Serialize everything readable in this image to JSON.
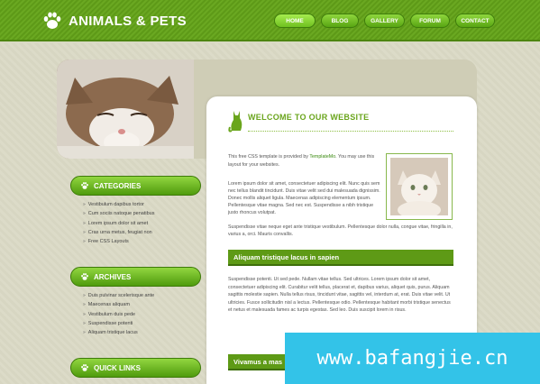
{
  "header": {
    "logo_text": "ANIMALS & PETS",
    "nav": [
      {
        "label": "HOME",
        "active": true,
        "w": 46
      },
      {
        "label": "BLOG",
        "active": false,
        "w": 42
      },
      {
        "label": "GALLERY",
        "active": false,
        "w": 45
      },
      {
        "label": "FORUM",
        "active": false,
        "w": 44
      },
      {
        "label": "CONTACT",
        "active": false,
        "w": 44
      }
    ]
  },
  "sidebar": {
    "categories": {
      "title": "CATEGORIES",
      "items": [
        "Vestibulum dapibus tortor",
        "Cum sociis natoque penatibus",
        "Lorem ipsum dolor sit amet",
        "Cras urna metus, feugiat non",
        "Free CSS Layouts"
      ]
    },
    "archives": {
      "title": "ARCHIVES",
      "items": [
        "Duis pulvinar scelerisque ante",
        "Maecenas aliquam",
        "Vestibulum duis pede",
        "Suspendisse potenti",
        "Aliquam tristique lacus"
      ]
    },
    "quick_links": {
      "title": "QUICK LINKS"
    }
  },
  "main": {
    "welcome_title": "WELCOME TO OUR WEBSITE",
    "intro_prefix": "This free CSS template is provided by",
    "intro_link": "TemplateMo",
    "intro_suffix": ". You may use this layout for your websites.",
    "para2": "Lorem ipsum dolor sit amet, consectetuer adipiscing elit. Nunc quis sem nec tellus blandit tincidunt. Duis vitae velit sed dui malesuada dignissim. Donec mollis aliquet ligula. Maecenas adipiscing elementum ipsum. Pellentesque vitae magna. Sed nec est. Suspendisse a nibh tristique justo rhoncus volutpat.",
    "para2b": "Suspendisse vitae neque eget ante tristique vestibulum. Pellentesque dolor nulla, congue vitae, fringilla in, varius a, orci. Mauris convallis.",
    "section1_title": "Aliquam tristique lacus in sapien",
    "para3": "Suspendisse potenti. Ut sed pede. Nullam vitae tellus. Sed ultrices. Lorem ipsum dolor sit amet, consectetuer adipiscing elit. Curabitur velit tellus, placerat et, dapibus varius, aliquet quis, purus. Aliquam sagittis molestie sapien. Nulla tellus risus, tincidunt vitae, sagittis vel, interdum at, erat. Duis vitae velit. Ut ultricies. Fusce sollicitudin nisl a lectus. Pellentesque odio. Pellentesque habitant morbi tristique senectus et netus et malesuada fames ac turpis egestas. Sed leo. Duis suscipit lorem in risus.",
    "section2_title": "Vivamus a mas"
  },
  "watermark": "www.bafangjie.cn",
  "colors": {
    "brand_green": "#5e9a16",
    "accent_light": "#92d640",
    "watermark_bg": "#33c3e8"
  }
}
